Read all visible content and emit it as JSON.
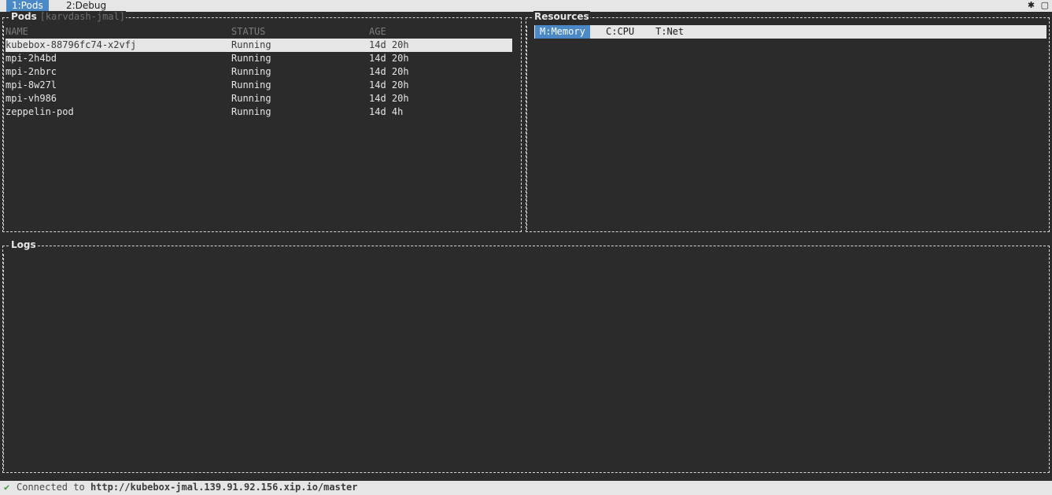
{
  "tabs": [
    {
      "label": "1:Pods",
      "active": true
    },
    {
      "label": "2:Debug",
      "active": false
    }
  ],
  "window_icons": {
    "left": "✱",
    "right": "▢"
  },
  "pods_panel": {
    "title": "Pods",
    "namespace": "[karvdash-jmal]",
    "columns": [
      "NAME",
      "STATUS",
      "AGE"
    ],
    "rows": [
      {
        "name": "kubebox-88796fc74-x2vfj",
        "status": "Running",
        "age": "14d 20h",
        "selected": true
      },
      {
        "name": "mpi-2h4bd",
        "status": "Running",
        "age": "14d 20h"
      },
      {
        "name": "mpi-2nbrc",
        "status": "Running",
        "age": "14d 20h"
      },
      {
        "name": "mpi-8w27l",
        "status": "Running",
        "age": "14d 20h"
      },
      {
        "name": "mpi-vh986",
        "status": "Running",
        "age": "14d 20h"
      },
      {
        "name": "zeppelin-pod",
        "status": "Running",
        "age": "14d 4h"
      }
    ]
  },
  "resources_panel": {
    "title": "Resources",
    "tabs": [
      {
        "label": "M:Memory",
        "active": true
      },
      {
        "label": "C:CPU",
        "active": false
      },
      {
        "label": "T:Net",
        "active": false
      }
    ]
  },
  "logs_panel": {
    "title": "Logs"
  },
  "status_bar": {
    "icon": "✔",
    "text": "Connected to",
    "url": "http://kubebox-jmal.139.91.92.156.xip.io/master"
  },
  "colors": {
    "background": "#2b2b2b",
    "accent": "#4a89c6",
    "bar": "#e6e6e6",
    "ok": "#3a9a3a"
  }
}
